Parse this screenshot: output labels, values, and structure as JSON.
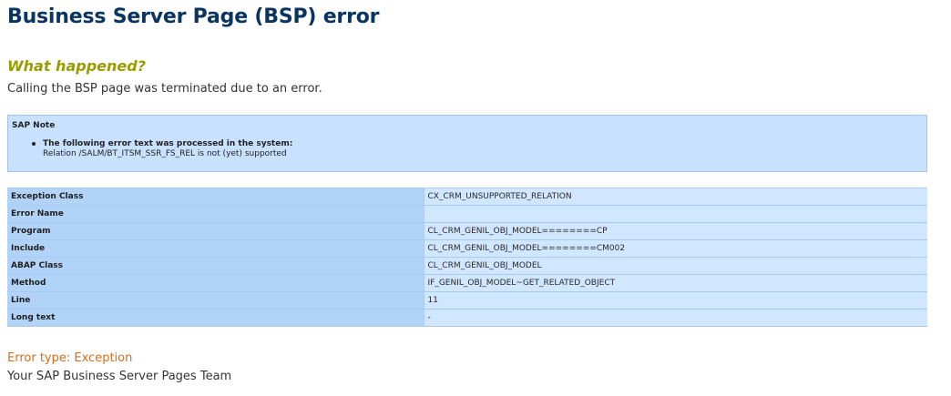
{
  "page": {
    "title": "Business Server Page (BSP) error",
    "section_heading": "What happened?",
    "intro": "Calling the BSP page was terminated due to an error."
  },
  "note": {
    "title": "SAP Note",
    "items": [
      {
        "title": "The following error text was processed in the system:",
        "detail": "Relation /SALM/BT_ITSM_SSR_FS_REL is not (yet) supported"
      }
    ]
  },
  "details": [
    {
      "label": "Exception Class",
      "value": "CX_CRM_UNSUPPORTED_RELATION"
    },
    {
      "label": "Error Name",
      "value": ""
    },
    {
      "label": "Program",
      "value": "CL_CRM_GENIL_OBJ_MODEL========CP"
    },
    {
      "label": "Include",
      "value": "CL_CRM_GENIL_OBJ_MODEL========CM002"
    },
    {
      "label": "ABAP Class",
      "value": "CL_CRM_GENIL_OBJ_MODEL"
    },
    {
      "label": "Method",
      "value": "IF_GENIL_OBJ_MODEL~GET_RELATED_OBJECT"
    },
    {
      "label": "Line",
      "value": "11"
    },
    {
      "label": "Long text",
      "value": "-"
    }
  ],
  "footer": {
    "error_type": "Error type: Exception",
    "team": "Your SAP Business Server Pages Team"
  },
  "colors": {
    "title": "#0a3560",
    "heading": "#9b9b00",
    "error_type": "#d46d1f",
    "note_bg": "#c8e1ff",
    "label_bg": "#b2d3f8",
    "value_bg": "#d1e6ff"
  }
}
